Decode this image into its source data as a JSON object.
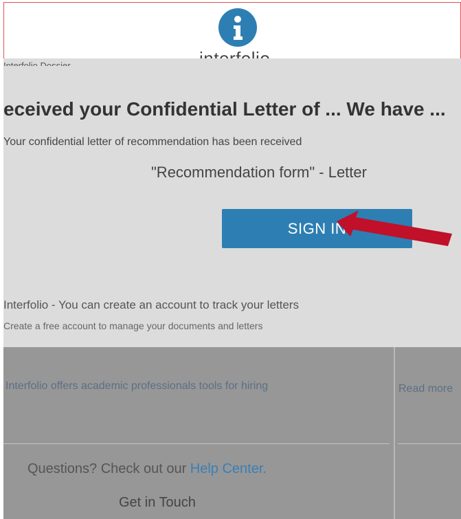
{
  "brand": {
    "name": "interfolio",
    "logo_icon": "info-icon",
    "accent_color": "#2d7fb3"
  },
  "header": {
    "line": "Interfolio Dossier"
  },
  "main": {
    "message": "eceived your Confidential Letter of ... We have ...",
    "sub_message": "Your confidential letter of recommendation has been received",
    "form_name": "\"Recommendation form\" - Letter",
    "sign_in_label": "SIGN IN",
    "info_line": "Interfolio - You can create an account to track your letters",
    "info_line_2": "Create a free account to manage your documents and letters"
  },
  "footer": {
    "left_text": "Interfolio offers academic professionals tools for hiring",
    "right_text": "Read more",
    "questions_prefix": "Questions? Check out our ",
    "help_center_label": "Help Center.",
    "get_in_touch_label": "Get in Touch",
    "bg_color": "#979797"
  },
  "annotation": {
    "arrow_color": "#c0102a"
  }
}
